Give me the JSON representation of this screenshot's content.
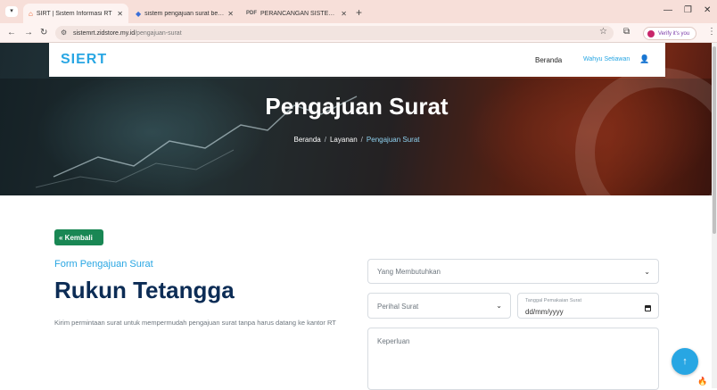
{
  "browser": {
    "tabs": [
      {
        "title": "SIRT | Sistem Informasi RT",
        "favicon_color": "#e8541e"
      },
      {
        "title": "sistem pengajuan surat berbasi",
        "favicon_color": "#3a6fd8"
      },
      {
        "title": "PERANCANGAN SISTEM INFOR",
        "favicon_color": "#555555"
      }
    ],
    "url_host": "sistemrt.zidstore.my.id",
    "url_path": "/pengajuan-surat",
    "profile_label": "Verify it's you"
  },
  "nav": {
    "logo": "SIERT",
    "link_home": "Beranda",
    "user_name": "Wahyu Setiawan"
  },
  "hero": {
    "title": "Pengajuan Surat",
    "breadcrumb": [
      "Beranda",
      "Layanan",
      "Pengajuan Surat"
    ]
  },
  "content": {
    "back_label": "« Kembali",
    "subtitle": "Form Pengajuan Surat",
    "title": "Rukun Tetangga",
    "description": "Kirim permintaan surat untuk mempermudah pengajuan surat tanpa harus datang ke kantor RT"
  },
  "form": {
    "needs_label": "Yang Membutuhkan",
    "subject_label": "Perihal Surat",
    "date_label": "Tanggal Pemakaian Surat",
    "date_value": "dd/mm/yyyy",
    "purpose_label": "Keperluan"
  },
  "colors": {
    "accent": "#28a6e3",
    "navy": "#0c2c55",
    "green": "#198754"
  }
}
